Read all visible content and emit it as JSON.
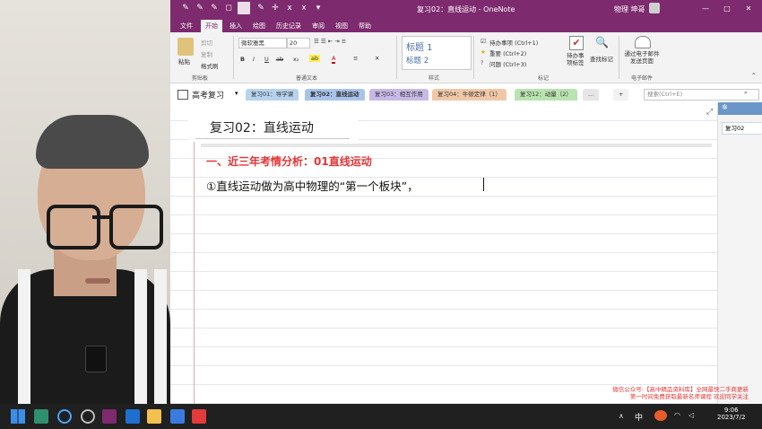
{
  "window": {
    "title": "复习02：直线运动 - OneNote",
    "user": "物理 坤哥",
    "controls": [
      "—",
      "□",
      "✕"
    ]
  },
  "ribbon_tabs": [
    "文件",
    "开始",
    "插入",
    "绘图",
    "历史记录",
    "审阅",
    "视图",
    "帮助"
  ],
  "active_tab": "开始",
  "ribbon": {
    "clipboard": {
      "paste": "粘贴",
      "cut": "剪切",
      "copy": "复制",
      "format_painter": "格式刷",
      "label": "剪贴板"
    },
    "basic_text": {
      "font": "微软雅黑",
      "size": "20",
      "label": "普通文本"
    },
    "styles": {
      "heading1": "标题 1",
      "heading2": "标题 2",
      "label": "样式"
    },
    "tags": {
      "todo": "待办事项 (Ctrl+1)",
      "important": "重要 (Ctrl+2)",
      "question": "问题 (Ctrl+3)",
      "todo_tag": "待办事项标签",
      "find_tags": "查找标记",
      "label": "标记"
    },
    "email": {
      "send": "通过电子邮件发送页面",
      "label": "电子邮件"
    }
  },
  "notebook": {
    "name": "高考复习"
  },
  "sections": [
    {
      "label": "复习01：导学课",
      "color": "#b6d3ef"
    },
    {
      "label": "复习02：直线运动",
      "color": "#a9c4ea"
    },
    {
      "label": "复习03：相互作用",
      "color": "#c9b9e6"
    },
    {
      "label": "复习04：牛顿定律（1）",
      "color": "#f0c8a8"
    },
    {
      "label": "复习12：动量（2）",
      "color": "#b9e3b0"
    },
    {
      "label": "...",
      "color": "#e6e6e6"
    }
  ],
  "search": {
    "placeholder": "搜索(Ctrl+E)"
  },
  "page": {
    "title": "复习02：直线运动",
    "heading": "一、近三年考情分析：01直线运动",
    "line1": "①直线运动做为高中物理的“第一个板块”，"
  },
  "page_list": {
    "items": [
      "复习02"
    ]
  },
  "overlay": {
    "line1": "微信公众号:【高中精品资料库】全网最快二手商更新",
    "line2": "第一时间免费获取最新名师课程 欢迎同学关注"
  },
  "taskbar": {
    "time": "9:06",
    "date": "2023/7/2",
    "ime": "中"
  },
  "colors": {
    "onenote_purple": "#7d2a6f",
    "heading_red": "#e23636"
  }
}
